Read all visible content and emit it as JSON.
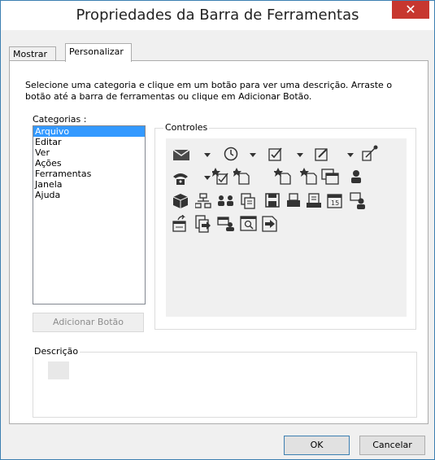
{
  "window": {
    "title": "Propriedades da Barra de Ferramentas",
    "close_glyph": "✕"
  },
  "tabs": [
    {
      "label": "Mostrar"
    },
    {
      "label": "Personalizar"
    }
  ],
  "instructions": "Selecione uma categoria e clique em um botão para ver uma descrição. Arraste o botão até a barra de ferramentas ou clique em Adicionar Botão.",
  "categories": {
    "label": "Categorias :",
    "items": [
      "Arquivo",
      "Editar",
      "Ver",
      "Ações",
      "Ferramentas",
      "Janela",
      "Ajuda"
    ],
    "selected": "Arquivo"
  },
  "controls": {
    "label": "Controles"
  },
  "add_button": {
    "label": "Adicionar Botão",
    "enabled": false
  },
  "description": {
    "label": "Descrição"
  },
  "footer": {
    "ok_label": "OK",
    "cancel_label": "Cancelar"
  },
  "icons": [
    "mail-icon",
    "dropdown-arrow-icon",
    "clock-icon",
    "dropdown-arrow-icon",
    "checkbox-task-icon",
    "dropdown-arrow-icon",
    "edit-note-icon",
    "dropdown-arrow-icon",
    "pin-note-icon",
    "phone-icon",
    "dropdown-arrow-icon",
    "new-task-icon",
    "new-item-icon",
    "new-item-star-icon",
    "new-item-copy-icon",
    "new-folder-icon",
    "contact-icon",
    "package-icon",
    "org-chart-icon",
    "group-contacts-icon",
    "form-icon",
    "save-icon",
    "printer-icon",
    "print-preview-icon",
    "calendar-icon",
    "contact-card-icon",
    "folder-open-icon",
    "move-to-icon",
    "contact-folder-icon",
    "view-icon",
    "import-icon"
  ]
}
